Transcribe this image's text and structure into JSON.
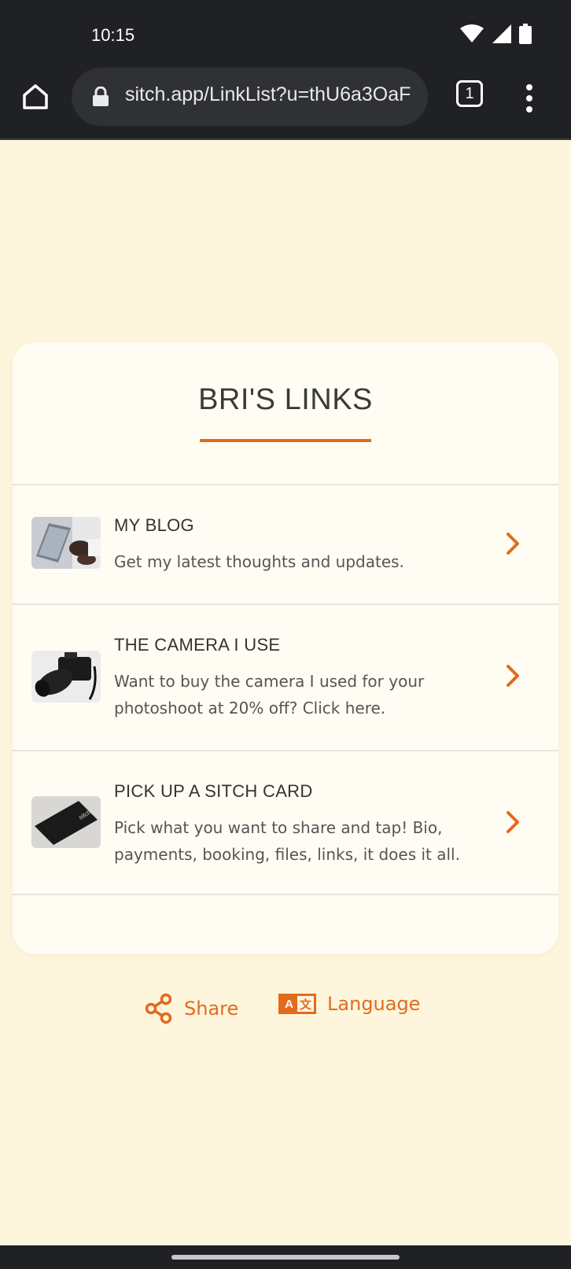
{
  "status_bar": {
    "time": "10:15"
  },
  "browser": {
    "url": "sitch.app/LinkList?u=thU6a3OaF",
    "tab_count": "1"
  },
  "card": {
    "title": "BRI'S LINKS",
    "links": [
      {
        "title": "MY BLOG",
        "description": "Get my latest thoughts and updates.",
        "thumbnail": "laptop-typing-photo"
      },
      {
        "title": "THE CAMERA I USE",
        "description": "Want to buy the camera I used for your photoshoot at 20% off? Click here.",
        "thumbnail": "dslr-camera-photo"
      },
      {
        "title": "PICK UP A SITCH CARD",
        "description": "Pick what you want to share and tap! Bio, payments, booking, files, links, it does it all.",
        "thumbnail": "sitch-card-photo"
      }
    ]
  },
  "footer": {
    "share_label": "Share",
    "language_label": "Language",
    "language_icon_left": "A",
    "language_icon_right": "文"
  },
  "colors": {
    "accent": "#e46a1d",
    "background": "#fdf6dd",
    "card": "#fffdf3",
    "chrome": "#202124"
  }
}
